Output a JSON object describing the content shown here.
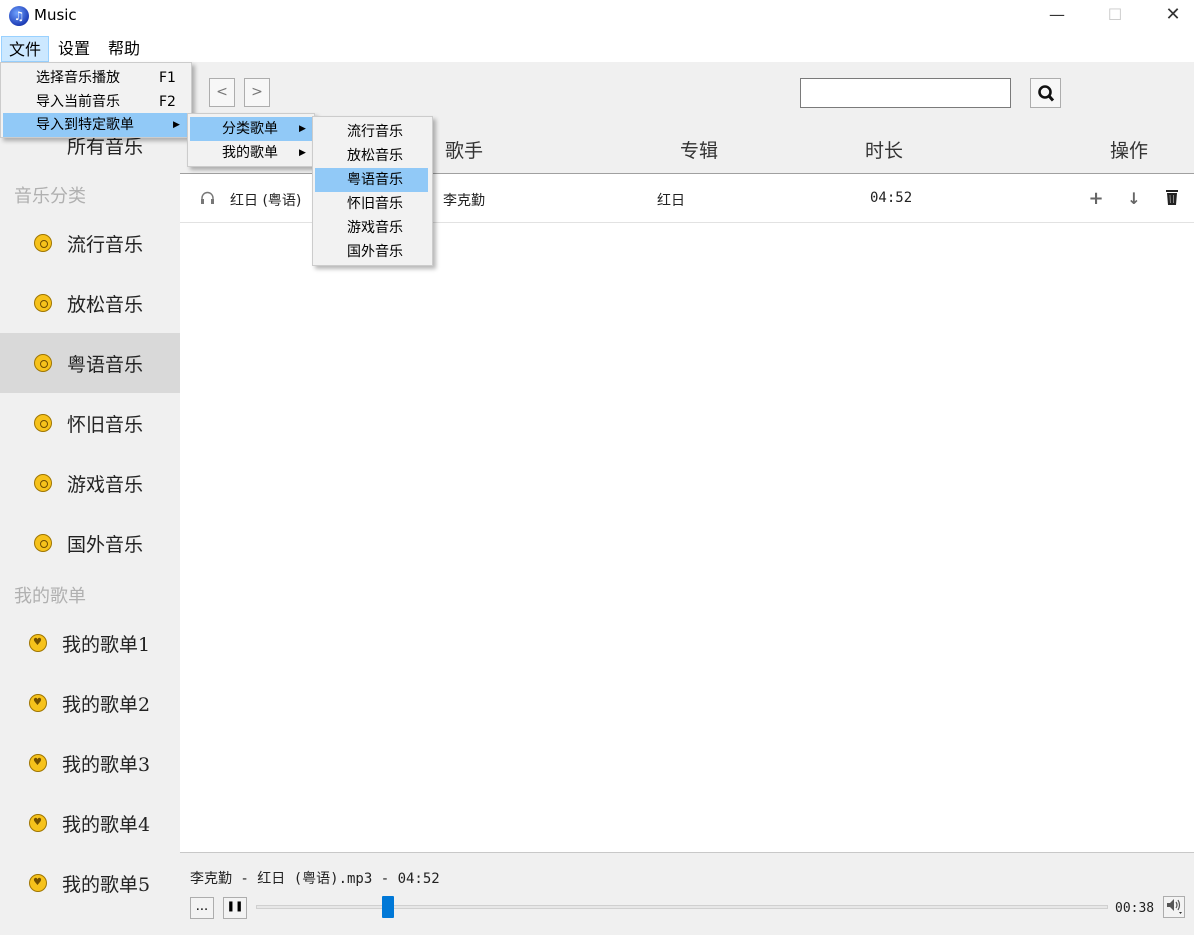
{
  "window": {
    "title": "Music",
    "minimize": "—",
    "maximize": "☐",
    "close": "✕"
  },
  "menubar": {
    "file": "文件",
    "settings": "设置",
    "help": "帮助"
  },
  "file_menu": {
    "items": [
      {
        "label": "选择音乐播放",
        "shortcut": "F1"
      },
      {
        "label": "导入当前音乐",
        "shortcut": "F2"
      },
      {
        "label": "导入到特定歌单",
        "arrow": "▶"
      }
    ]
  },
  "submenu": {
    "items": [
      {
        "label": "分类歌单",
        "arrow": "▶"
      },
      {
        "label": "我的歌单",
        "arrow": "▶"
      }
    ]
  },
  "category_menu": {
    "items": [
      "流行音乐",
      "放松音乐",
      "粤语音乐",
      "怀旧音乐",
      "游戏音乐",
      "国外音乐"
    ],
    "highlighted": "粤语音乐"
  },
  "toolbar": {
    "back": "<",
    "forward": ">",
    "search_placeholder": ""
  },
  "sidebar": {
    "all_music": "所有音乐",
    "category_header": "音乐分类",
    "categories": [
      "流行音乐",
      "放松音乐",
      "粤语音乐",
      "怀旧音乐",
      "游戏音乐",
      "国外音乐"
    ],
    "selected": "粤语音乐",
    "playlist_header": "我的歌单",
    "playlists": [
      "我的歌单1",
      "我的歌单2",
      "我的歌单3",
      "我的歌单4",
      "我的歌单5"
    ]
  },
  "table": {
    "columns": {
      "singer": "歌手",
      "album": "专辑",
      "duration": "时长",
      "actions": "操作"
    },
    "rows": [
      {
        "title": "红日 (粤语)",
        "singer": "李克勤",
        "album": "红日",
        "duration": "04:52"
      }
    ]
  },
  "player": {
    "now_playing": "李克勤 - 红日 (粤语).mp3 - 04:52",
    "more": "...",
    "pause": "❚❚",
    "elapsed": "00:38",
    "progress": 0.155
  },
  "colors": {
    "accent": "#0078d7",
    "menu_highlight": "#91c9f7",
    "sidebar_bg": "#f0f0f0",
    "icon_gold": "#f6c21b"
  }
}
